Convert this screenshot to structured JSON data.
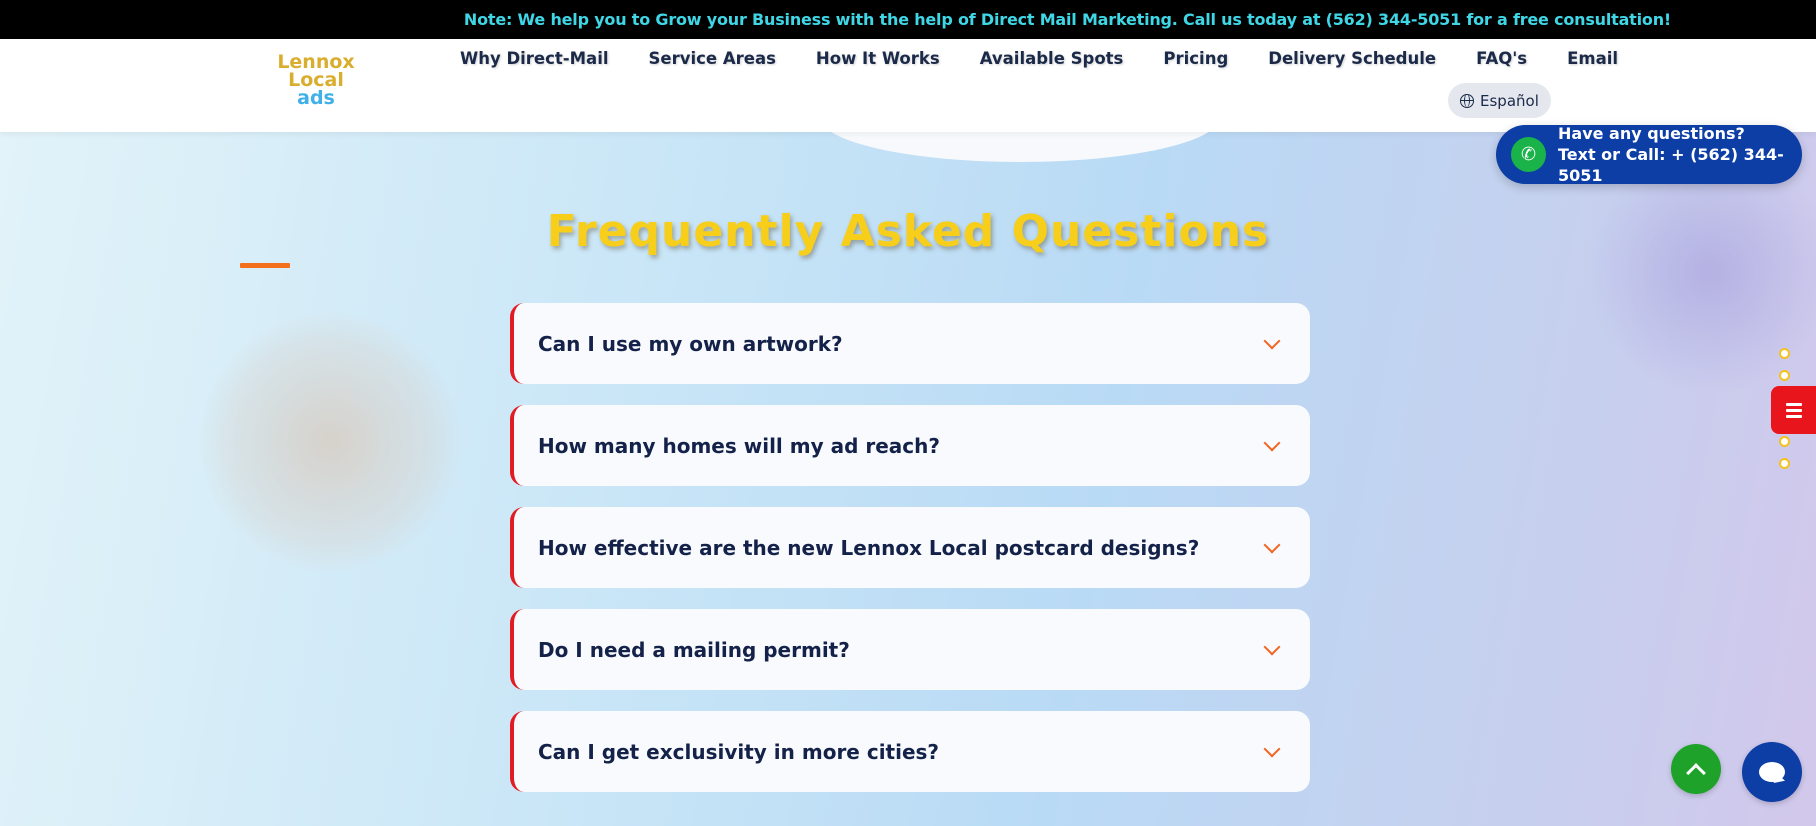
{
  "topbar": {
    "note": "Note: We help you to Grow your Business with the help of Direct Mail Marketing. Call us today at (562) 344-5051 for a free consultation!"
  },
  "logo": {
    "line1": "Lennox",
    "line2": "Local",
    "line3": "ads"
  },
  "nav": {
    "items": [
      {
        "label": "Why Direct-Mail"
      },
      {
        "label": "Service Areas"
      },
      {
        "label": "How It Works"
      },
      {
        "label": "Available Spots"
      },
      {
        "label": "Pricing"
      },
      {
        "label": "Delivery Schedule"
      },
      {
        "label": "FAQ's"
      },
      {
        "label": "Email"
      }
    ],
    "language_label": "Español"
  },
  "faq": {
    "title": "Frequently Asked Questions",
    "questions": [
      {
        "q": "Can I use my own artwork?"
      },
      {
        "q": "How many homes will my ad reach?"
      },
      {
        "q": "How effective are the new Lennox Local postcard designs?"
      },
      {
        "q": "Do I need a mailing permit?"
      },
      {
        "q": "Can I get exclusivity in more cities?"
      }
    ]
  },
  "call_widget": {
    "line1": "Have any questions?",
    "line2": "Text or Call: + (562) 344-5051"
  },
  "colors": {
    "accent_title": "#f7cf1a",
    "faq_border": "#e21c23",
    "chevron": "#f26522",
    "call_widget_bg": "#0c3ea6",
    "topbar_text": "#3fd6e6"
  }
}
